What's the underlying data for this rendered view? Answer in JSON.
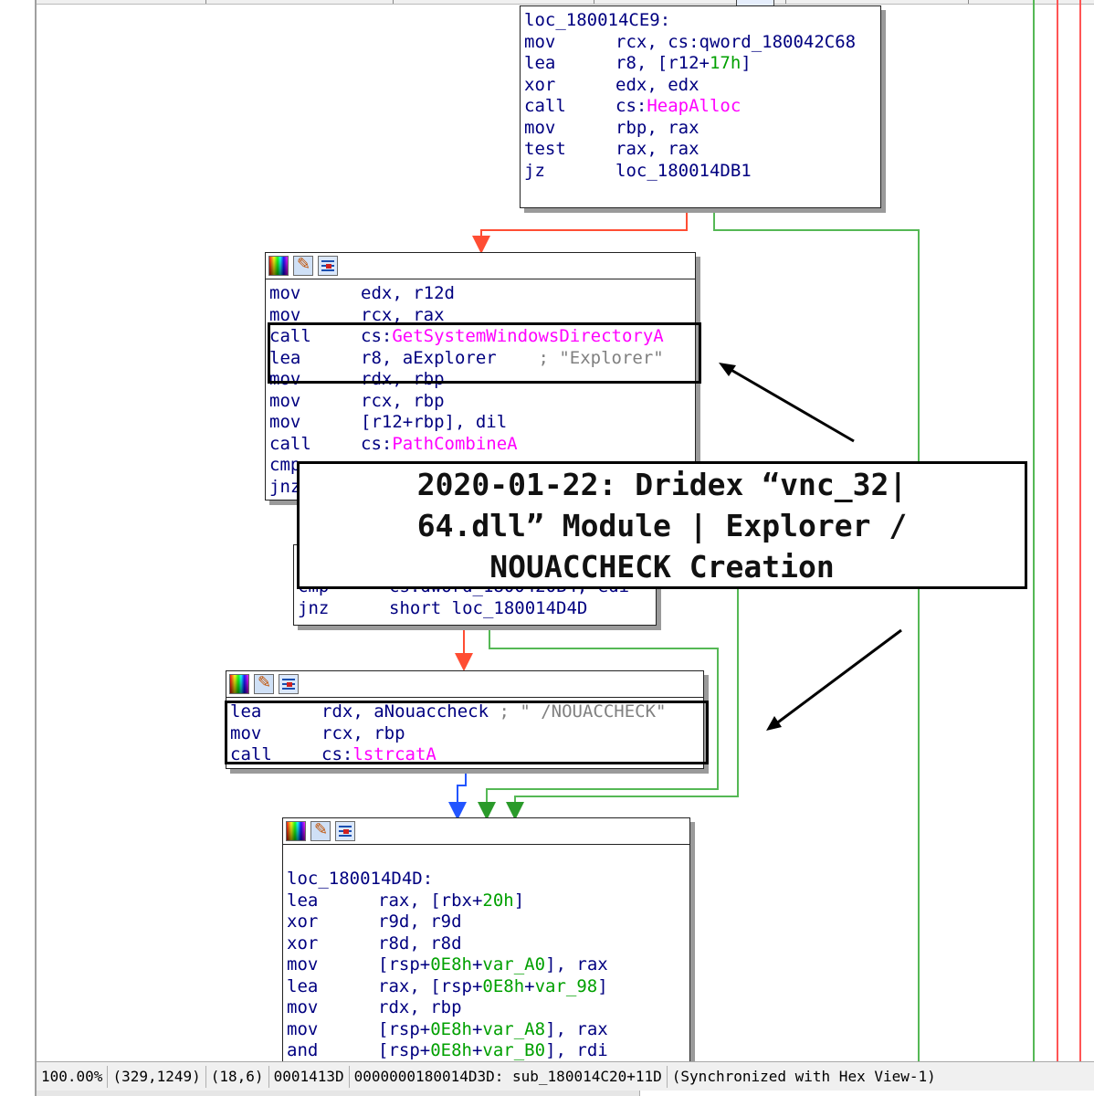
{
  "nodes": {
    "top": {
      "label": "loc_180014CE9:",
      "lines": [
        {
          "mn": "mov",
          "parts": [
            {
              "t": "rcx, cs:qword_180042C68",
              "c": "op"
            }
          ]
        },
        {
          "mn": "lea",
          "parts": [
            {
              "t": "r8, [r12+",
              "c": "op"
            },
            {
              "t": "17h",
              "c": "num"
            },
            {
              "t": "]",
              "c": "op"
            }
          ]
        },
        {
          "mn": "xor",
          "parts": [
            {
              "t": "edx, edx",
              "c": "op"
            }
          ]
        },
        {
          "mn": "call",
          "parts": [
            {
              "t": "cs:",
              "c": "op"
            },
            {
              "t": "HeapAlloc",
              "c": "api"
            }
          ]
        },
        {
          "mn": "mov",
          "parts": [
            {
              "t": "rbp, rax",
              "c": "op"
            }
          ]
        },
        {
          "mn": "test",
          "parts": [
            {
              "t": "rax, rax",
              "c": "op"
            }
          ]
        },
        {
          "mn": "jz",
          "parts": [
            {
              "t": "loc_180014DB1",
              "c": "op"
            }
          ]
        }
      ]
    },
    "second": {
      "lines": [
        {
          "mn": "mov",
          "parts": [
            {
              "t": "edx, r12d",
              "c": "op"
            }
          ]
        },
        {
          "mn": "mov",
          "parts": [
            {
              "t": "rcx, rax",
              "c": "op"
            }
          ]
        },
        {
          "mn": "call",
          "parts": [
            {
              "t": "cs:",
              "c": "op"
            },
            {
              "t": "GetSystemWindowsDirectoryA",
              "c": "api"
            }
          ]
        },
        {
          "mn": "lea",
          "parts": [
            {
              "t": "r8, aExplorer    ",
              "c": "op"
            },
            {
              "t": "; \"Explorer\"",
              "c": "cmt"
            }
          ]
        },
        {
          "mn": "mov",
          "parts": [
            {
              "t": "rdx, rbp",
              "c": "op"
            }
          ]
        },
        {
          "mn": "mov",
          "parts": [
            {
              "t": "rcx, rbp",
              "c": "op"
            }
          ]
        },
        {
          "mn": "mov",
          "parts": [
            {
              "t": "[r12+rbp], dil",
              "c": "op"
            }
          ]
        },
        {
          "mn": "call",
          "parts": [
            {
              "t": "cs:",
              "c": "op"
            },
            {
              "t": "PathCombineA",
              "c": "api"
            }
          ]
        },
        {
          "mn": "cmp",
          "parts": [
            {
              "t": "",
              "c": "op"
            }
          ]
        },
        {
          "mn": "jnz",
          "parts": [
            {
              "t": "",
              "c": "op"
            }
          ]
        }
      ]
    },
    "third": {
      "lines": [
        {
          "mn": "cmp",
          "parts": [
            {
              "t": "cs:dword_1800420B4, edi",
              "c": "op"
            }
          ]
        },
        {
          "mn": "jnz",
          "parts": [
            {
              "t": "short loc_180014D4D",
              "c": "op"
            }
          ]
        }
      ]
    },
    "fourth": {
      "lines": [
        {
          "mn": "lea",
          "parts": [
            {
              "t": "rdx, aNouaccheck ",
              "c": "op"
            },
            {
              "t": "; \" /NOUACCHECK\"",
              "c": "cmt"
            }
          ]
        },
        {
          "mn": "mov",
          "parts": [
            {
              "t": "rcx, rbp",
              "c": "op"
            }
          ]
        },
        {
          "mn": "call",
          "parts": [
            {
              "t": "cs:",
              "c": "op"
            },
            {
              "t": "lstrcatA",
              "c": "api"
            }
          ]
        }
      ]
    },
    "bottom": {
      "label": "loc_180014D4D:",
      "lines": [
        {
          "mn": "lea",
          "parts": [
            {
              "t": "rax, [rbx+",
              "c": "op"
            },
            {
              "t": "20h",
              "c": "num"
            },
            {
              "t": "]",
              "c": "op"
            }
          ]
        },
        {
          "mn": "xor",
          "parts": [
            {
              "t": "r9d, r9d",
              "c": "op"
            }
          ]
        },
        {
          "mn": "xor",
          "parts": [
            {
              "t": "r8d, r8d",
              "c": "op"
            }
          ]
        },
        {
          "mn": "mov",
          "parts": [
            {
              "t": "[rsp+",
              "c": "op"
            },
            {
              "t": "0E8h",
              "c": "num"
            },
            {
              "t": "+",
              "c": "op"
            },
            {
              "t": "var_A0",
              "c": "num"
            },
            {
              "t": "], rax",
              "c": "op"
            }
          ]
        },
        {
          "mn": "lea",
          "parts": [
            {
              "t": "rax, [rsp+",
              "c": "op"
            },
            {
              "t": "0E8h",
              "c": "num"
            },
            {
              "t": "+",
              "c": "op"
            },
            {
              "t": "var_98",
              "c": "num"
            },
            {
              "t": "]",
              "c": "op"
            }
          ]
        },
        {
          "mn": "mov",
          "parts": [
            {
              "t": "rdx, rbp",
              "c": "op"
            }
          ]
        },
        {
          "mn": "mov",
          "parts": [
            {
              "t": "[rsp+",
              "c": "op"
            },
            {
              "t": "0E8h",
              "c": "num"
            },
            {
              "t": "+",
              "c": "op"
            },
            {
              "t": "var_A8",
              "c": "num"
            },
            {
              "t": "], rax",
              "c": "op"
            }
          ]
        },
        {
          "mn": "and",
          "parts": [
            {
              "t": "[rsp+",
              "c": "op"
            },
            {
              "t": "0E8h",
              "c": "num"
            },
            {
              "t": "+",
              "c": "op"
            },
            {
              "t": "var_B0",
              "c": "num"
            },
            {
              "t": "], rdi",
              "c": "op"
            }
          ]
        }
      ]
    }
  },
  "overlay": {
    "title": "2020-01-22: Dridex “vnc_32|\n64.dll” Module | Explorer /\nNOUACCHECK Creation"
  },
  "status": {
    "zoom": "100.00%",
    "mouse_pos": "(329,1249)",
    "cursor_pos": "(18,6)",
    "file_offset": "0001413D",
    "address": "0000000180014D3D: sub_180014C20+11D",
    "sync": "(Synchronized with Hex View-1)"
  },
  "colors": {
    "edge_true": "#ff4d33",
    "edge_false": "#55b855",
    "edge_uncond": "#2255ff",
    "mnemonic": "#000080",
    "api": "#ff00ff",
    "number": "#00a000",
    "comment": "#808080"
  },
  "icons": [
    "color-palette-icon",
    "rename-pencil-icon",
    "graph-view-icon"
  ]
}
